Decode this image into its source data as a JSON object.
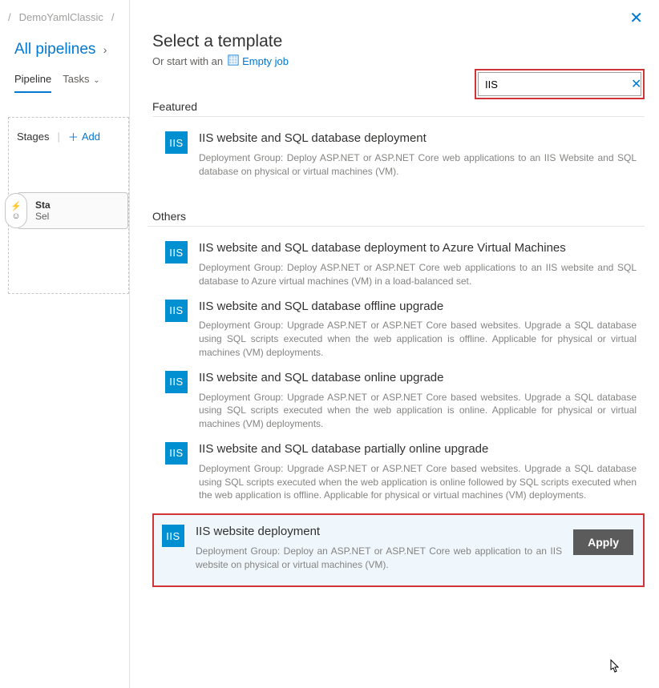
{
  "breadcrumb": {
    "title": "DemoYamlClassic"
  },
  "header": {
    "all_pipelines": "All pipelines"
  },
  "tabs": {
    "pipeline": "Pipeline",
    "tasks": "Tasks"
  },
  "stages": {
    "label": "Stages",
    "add": "Add",
    "card_title": "Sta",
    "card_sub": "Sel"
  },
  "panel": {
    "title": "Select a template",
    "subtitle_prefix": "Or start with an",
    "empty_job": "Empty job"
  },
  "search": {
    "value": "IIS"
  },
  "sections": {
    "featured": "Featured",
    "others": "Others"
  },
  "templates": {
    "featured": [
      {
        "title": "IIS website and SQL database deployment",
        "desc": "Deployment Group: Deploy ASP.NET or ASP.NET Core web applications to an IIS Website and SQL database on physical or virtual machines (VM)."
      }
    ],
    "others": [
      {
        "title": "IIS website and SQL database deployment to Azure Virtual Machines",
        "desc": "Deployment Group: Deploy ASP.NET or ASP.NET Core web applications to an IIS website and SQL database to Azure virtual machines (VM) in a load-balanced set."
      },
      {
        "title": "IIS website and SQL database offline upgrade",
        "desc": "Deployment Group: Upgrade ASP.NET or ASP.NET Core based websites. Upgrade a SQL database using SQL scripts executed when the web application is offline. Applicable for physical or virtual machines (VM) deployments."
      },
      {
        "title": "IIS website and SQL database online upgrade",
        "desc": "Deployment Group: Upgrade ASP.NET or ASP.NET Core based websites. Upgrade a SQL database using SQL scripts executed when the web application is online. Applicable for physical or virtual machines (VM) deployments."
      },
      {
        "title": "IIS website and SQL database partially online upgrade",
        "desc": "Deployment Group: Upgrade ASP.NET or ASP.NET Core based websites. Upgrade a SQL database using SQL scripts executed when the web application is online followed by SQL scripts executed when the web application is offline. Applicable for physical or virtual machines (VM) deployments."
      }
    ],
    "selected": {
      "title": "IIS website deployment",
      "desc": "Deployment Group: Deploy an ASP.NET or ASP.NET Core web application to an IIS website on physical or virtual machines (VM)."
    }
  },
  "buttons": {
    "apply": "Apply"
  },
  "icon_label": "IIS"
}
